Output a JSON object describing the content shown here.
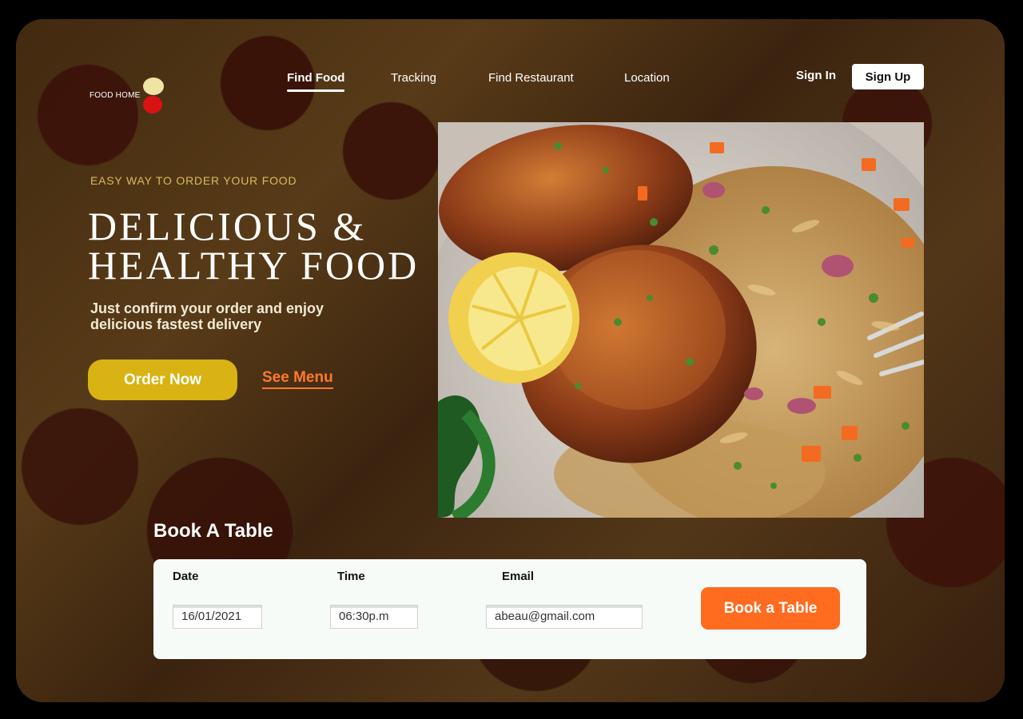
{
  "brand": {
    "logo_text": "FOOD HOME"
  },
  "nav": {
    "items": [
      {
        "label": "Find Food",
        "active": true
      },
      {
        "label": "Tracking",
        "active": false
      },
      {
        "label": "Find Restaurant",
        "active": false
      },
      {
        "label": "Location",
        "active": false
      }
    ],
    "sign_in": "Sign In",
    "sign_up": "Sign Up"
  },
  "hero": {
    "eyebrow": "EASY WAY TO ORDER YOUR FOOD",
    "title_line_1": "DELICIOUS &",
    "title_line_2": "HEALTHY FOOD",
    "subtitle_line_1": "Just confirm your order and enjoy",
    "subtitle_line_2": "delicious fastest delivery",
    "order_now": "Order Now",
    "see_menu": "See Menu"
  },
  "booking": {
    "title": "Book A Table",
    "date_label": "Date",
    "date_value": "16/01/2021",
    "time_label": "Time",
    "time_value": "06:30p.m",
    "email_label": "Email",
    "email_value": "abeau@gmail.com",
    "button": "Book a Table"
  },
  "colors": {
    "accent_yellow": "#d8b313",
    "accent_orange": "#ff6b1f",
    "eyebrow": "#d9bb5e",
    "logo_red": "#d91313"
  }
}
